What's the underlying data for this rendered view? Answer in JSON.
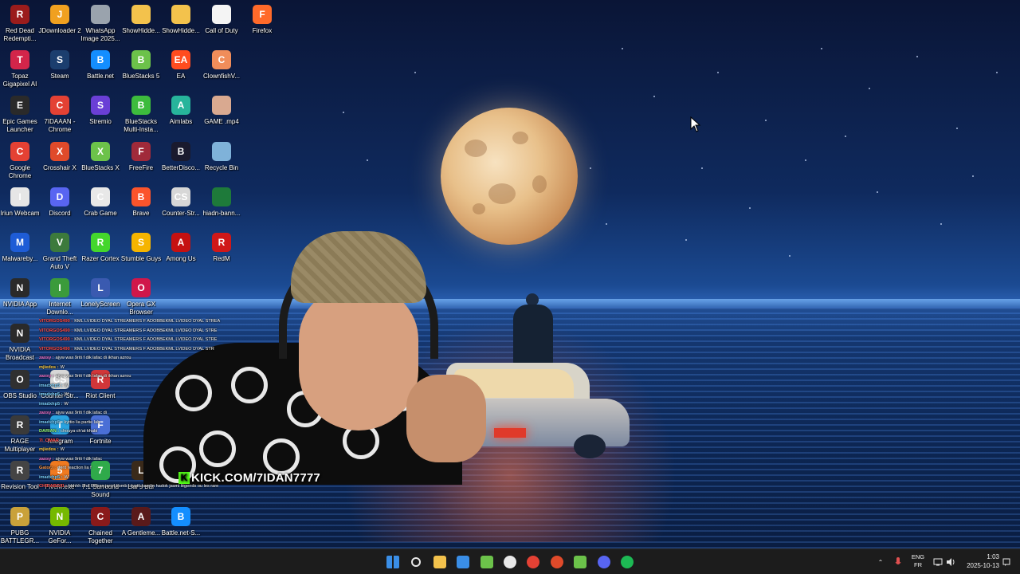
{
  "desktop_icons": [
    {
      "label": "Red Dead Redempti...",
      "icon": "red-dead-icon",
      "color": "#9b1c1c",
      "glyph": "R"
    },
    {
      "label": "JDownloader 2",
      "icon": "jdownloader-icon",
      "color": "#f0a020",
      "glyph": "J"
    },
    {
      "label": "WhatsApp Image 2025...",
      "icon": "image-file-icon",
      "color": "#9aa3ad",
      "glyph": ""
    },
    {
      "label": "ShowHidde...",
      "icon": "folder-icon",
      "color": "#f3c24c",
      "glyph": ""
    },
    {
      "label": "ShowHidde...",
      "icon": "folder-icon",
      "color": "#f3c24c",
      "glyph": ""
    },
    {
      "label": "Call of Duty",
      "icon": "document-icon",
      "color": "#f4f4f4",
      "glyph": ""
    },
    {
      "label": "Firefox",
      "icon": "firefox-icon",
      "color": "#ff6a2a",
      "glyph": "F"
    },
    {
      "label": "Topaz Gigapixel AI",
      "icon": "topaz-icon",
      "color": "#d3254a",
      "glyph": "T"
    },
    {
      "label": "Steam",
      "icon": "steam-icon",
      "color": "#1b3e6e",
      "glyph": "S"
    },
    {
      "label": "Battle.net",
      "icon": "battlenet-icon",
      "color": "#148eff",
      "glyph": "B"
    },
    {
      "label": "BlueStacks 5",
      "icon": "bluestacks-icon",
      "color": "#6cc24a",
      "glyph": "B"
    },
    {
      "label": "EA",
      "icon": "ea-icon",
      "color": "#ff4c1f",
      "glyph": "EA"
    },
    {
      "label": "ClownfishV...",
      "icon": "clownfish-icon",
      "color": "#f08d5a",
      "glyph": "C"
    },
    {
      "label": "Epic Games Launcher",
      "icon": "epic-games-icon",
      "color": "#2a2a2a",
      "glyph": "E"
    },
    {
      "label": "7IDAAAN - Chrome",
      "icon": "chrome-icon",
      "color": "#e44134",
      "glyph": "C"
    },
    {
      "label": "Stremio",
      "icon": "stremio-icon",
      "color": "#6a3fd6",
      "glyph": "S"
    },
    {
      "label": "BlueStacks Multi-Insta...",
      "icon": "bluestacks-multi-icon",
      "color": "#3dbb3d",
      "glyph": "B"
    },
    {
      "label": "Aimlabs",
      "icon": "aimlabs-icon",
      "color": "#27b49b",
      "glyph": "A"
    },
    {
      "label": "GAME .mp4",
      "icon": "video-file-icon",
      "color": "#d9a990",
      "glyph": ""
    },
    {
      "label": "Google Chrome",
      "icon": "chrome-icon",
      "color": "#e44134",
      "glyph": "C"
    },
    {
      "label": "Crosshair X",
      "icon": "crosshair-icon",
      "color": "#e04a2a",
      "glyph": "X"
    },
    {
      "label": "BlueStacks X",
      "icon": "bluestacks-x-icon",
      "color": "#6cc24a",
      "glyph": "X"
    },
    {
      "label": "FreeFire",
      "icon": "freefire-icon",
      "color": "#a02a3a",
      "glyph": "F"
    },
    {
      "label": "BetterDisco...",
      "icon": "betterdiscord-icon",
      "color": "#1a1a2e",
      "glyph": "B"
    },
    {
      "label": "Recycle Bin",
      "icon": "recycle-bin-icon",
      "color": "#7fb2d9",
      "glyph": ""
    },
    {
      "label": "Iriun Webcam",
      "icon": "iriun-webcam-icon",
      "color": "#e6e6e6",
      "glyph": "I"
    },
    {
      "label": "Discord",
      "icon": "discord-icon",
      "color": "#5865f2",
      "glyph": "D"
    },
    {
      "label": "Crab Game",
      "icon": "crab-game-icon",
      "color": "#e8e8e8",
      "glyph": "C"
    },
    {
      "label": "Brave",
      "icon": "brave-icon",
      "color": "#fb542b",
      "glyph": "B"
    },
    {
      "label": "Counter-Str...",
      "icon": "counter-strike-icon",
      "color": "#d7d7d7",
      "glyph": "CS"
    },
    {
      "label": "hiadn-bann...",
      "icon": "banner-file-icon",
      "color": "#1e7a3a",
      "glyph": ""
    },
    {
      "label": "Malwareby...",
      "icon": "malwarebytes-icon",
      "color": "#1e5cd6",
      "glyph": "M"
    },
    {
      "label": "Grand Theft Auto V",
      "icon": "gta-icon",
      "color": "#3c7a3c",
      "glyph": "V"
    },
    {
      "label": "Razer Cortex",
      "icon": "razer-cortex-icon",
      "color": "#44d62c",
      "glyph": "R"
    },
    {
      "label": "Stumble Guys",
      "icon": "stumble-guys-icon",
      "color": "#f5b400",
      "glyph": "S"
    },
    {
      "label": "Among Us",
      "icon": "among-us-icon",
      "color": "#c51111",
      "glyph": "A"
    },
    {
      "label": "RedM",
      "icon": "redm-icon",
      "color": "#d01818",
      "glyph": "R"
    },
    {
      "label": "NVIDIA App",
      "icon": "nvidia-icon",
      "color": "#2a2a2a",
      "glyph": "N"
    },
    {
      "label": "Internet Downlo...",
      "icon": "idm-icon",
      "color": "#3b9b3b",
      "glyph": "I"
    },
    {
      "label": "LonelyScreen",
      "icon": "lonelyscreen-icon",
      "color": "#3a5ab0",
      "glyph": "L"
    },
    {
      "label": "Opera GX Browser",
      "icon": "opera-gx-icon",
      "color": "#d0174a",
      "glyph": "O"
    },
    {
      "label": "NVIDIA Broadcast",
      "icon": "nvidia-broadcast-icon",
      "color": "#2a2a2a",
      "glyph": "N"
    },
    {
      "label": "OBS Studio",
      "icon": "obs-icon",
      "color": "#303030",
      "glyph": "O"
    },
    {
      "label": "Counter-Str...",
      "icon": "counter-strike-icon",
      "color": "#d7d7d7",
      "glyph": "CS"
    },
    {
      "label": "Riot Client",
      "icon": "riot-client-icon",
      "color": "#d13639",
      "glyph": "R"
    },
    {
      "label": "RAGE Multiplayer",
      "icon": "rage-mp-icon",
      "color": "#3a3a3a",
      "glyph": "R"
    },
    {
      "label": "Telegram",
      "icon": "telegram-icon",
      "color": "#2aa3e0",
      "glyph": "T"
    },
    {
      "label": "Fortnite",
      "icon": "fortnite-icon",
      "color": "#4a6fd6",
      "glyph": "F"
    },
    {
      "label": "Revision Tool",
      "icon": "revision-tool-icon",
      "color": "#444",
      "glyph": "R"
    },
    {
      "label": "FiveM.exe",
      "icon": "fivem-icon",
      "color": "#f07a20",
      "glyph": "5"
    },
    {
      "label": "7.1 Surround Sound",
      "icon": "surround-sound-icon",
      "color": "#2faa4a",
      "glyph": "7"
    },
    {
      "label": "Liar's Bar",
      "icon": "liars-bar-icon",
      "color": "#3a2a1a",
      "glyph": "L"
    },
    {
      "label": "PUBG BATTLEGR...",
      "icon": "pubg-icon",
      "color": "#c9a13a",
      "glyph": "P"
    },
    {
      "label": "NVIDIA GeFor...",
      "icon": "nvidia-geforce-icon",
      "color": "#76b900",
      "glyph": "N"
    },
    {
      "label": "Chained Together",
      "icon": "chained-together-icon",
      "color": "#8a1a1a",
      "glyph": "C"
    },
    {
      "label": "A Gentleme...",
      "icon": "gentlemen-icon",
      "color": "#5a1a1a",
      "glyph": "A"
    },
    {
      "label": "Battle.net-S...",
      "icon": "battlenet-icon",
      "color": "#148eff",
      "glyph": "B"
    }
  ],
  "stream_overlay": {
    "kick_url": "KICK.COM/7IDAN7777",
    "chat": [
      {
        "user": "VITORGOS490 :",
        "text": "KML LVIDEO DYAL STREAMERS F ADOBBEKML LVIDEO DYAL STREA",
        "color": "#ff4d4d"
      },
      {
        "user": "VITORGOS490 :",
        "text": "KML LVIDEO DYAL STREAMERS F ADOBBEKML LVIDEO DYAL STRE",
        "color": "#ff4d4d"
      },
      {
        "user": "VITORGOS490 :",
        "text": "KML LVIDEO DYAL STREAMERS F ADOBBEKML LVIDEO DYAL STRE",
        "color": "#ff4d4d"
      },
      {
        "user": "VITORGOS490 :",
        "text": "KML LVIDEO DYAL STREAMERS F ADOBBEKML LVIDEO DYAL STR",
        "color": "#ff4d4d"
      },
      {
        "user": "zaxsy :",
        "text": "ajyw wax 9riti f dik lafac di ikhan azrou",
        "color": "#ff7ad9"
      },
      {
        "user": "mjiedos :",
        "text": "W",
        "color": "#ffd24d"
      },
      {
        "user": "zaxsy :",
        "text": "ajyw wax 9riti f dik lafac di ikhan azrou",
        "color": "#ff7ad9"
      },
      {
        "user": "imadxhp5 :",
        "text": "W",
        "color": "#7ad1ff"
      },
      {
        "user": "imadxhp5 :",
        "text": "W",
        "color": "#7ad1ff"
      },
      {
        "user": "imadxhp5 :",
        "text": "W",
        "color": "#7ad1ff"
      },
      {
        "user": "zaxsy :",
        "text": "ajyw wax 9riti f dik lafac di",
        "color": "#ff7ad9"
      },
      {
        "user": "imadxhp5 :",
        "text": "kyttio lia partie lah",
        "color": "#7ad1ff"
      },
      {
        "user": "DARIAN :",
        "text": "chouya ch'at khabi",
        "color": "#9cff7a"
      },
      {
        "user": "7I_OMAR :",
        "text": "",
        "color": "#ff4d4d"
      },
      {
        "user": "mjiedos :",
        "text": "W",
        "color": "#ffd24d"
      },
      {
        "user": "zaxsy :",
        "text": "ajyw wax 9riti f dik lafac",
        "color": "#ff7ad9"
      },
      {
        "user": "Gatorz :",
        "text": "dorit reaction lia f",
        "color": "#ff9a4d"
      },
      {
        "user": "imadxhp5 :",
        "text": "W",
        "color": "#7ad1ff"
      },
      {
        "user": "CHIHABOXI :",
        "text": "hhhhh ana l9riban jani f bomb crypto kamlin hadok jawni légends ou les rare",
        "color": "#ff4d4d"
      }
    ]
  },
  "taskbar": {
    "apps": [
      {
        "name": "start-button",
        "icon": "windows-start-icon",
        "color": "#3a8ee6"
      },
      {
        "name": "search-button",
        "icon": "search-icon",
        "color": "#e8e8e8"
      },
      {
        "name": "file-explorer-button",
        "icon": "folder-icon",
        "color": "#f3c24c"
      },
      {
        "name": "microsoft-store-button",
        "icon": "store-icon",
        "color": "#3a8ee6"
      },
      {
        "name": "bluestacks-taskbar-button",
        "icon": "bluestacks-icon",
        "color": "#6cc24a"
      },
      {
        "name": "obs-taskbar-button",
        "icon": "obs-icon",
        "color": "#e8e8e8"
      },
      {
        "name": "chrome-taskbar-button",
        "icon": "chrome-icon",
        "color": "#e44134"
      },
      {
        "name": "crosshair-taskbar-button",
        "icon": "crosshair-icon",
        "color": "#e04a2a"
      },
      {
        "name": "bluestacks-x-taskbar-button",
        "icon": "bluestacks-x-icon",
        "color": "#6cc24a"
      },
      {
        "name": "discord-taskbar-button",
        "icon": "discord-icon",
        "color": "#5865f2"
      },
      {
        "name": "spotify-taskbar-button",
        "icon": "spotify-icon",
        "color": "#1db954"
      }
    ],
    "language": "ENG",
    "region": "FR",
    "time": "1:03",
    "date": "2025-10-13"
  }
}
